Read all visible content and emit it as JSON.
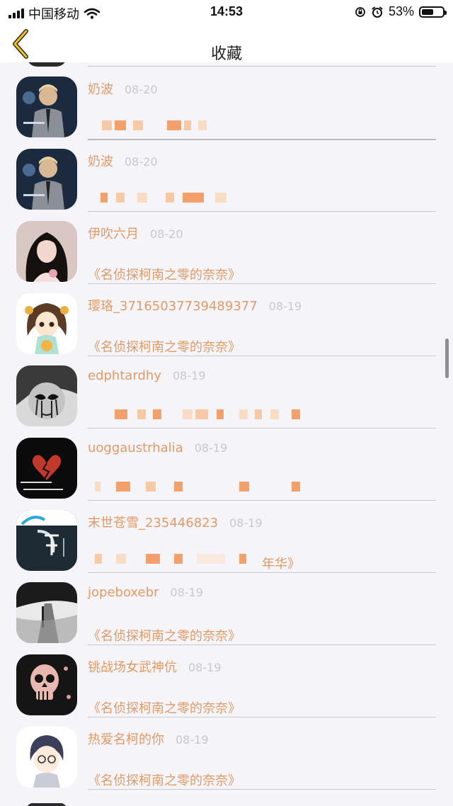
{
  "status_bar": {
    "carrier": "中国移动",
    "time": "14:53",
    "battery": "53%"
  },
  "nav": {
    "title": "收藏"
  },
  "items": [
    {
      "name": "奶波",
      "date": "08-20",
      "content": ""
    },
    {
      "name": "奶波",
      "date": "08-20",
      "content": ""
    },
    {
      "name": "伊吹六月",
      "date": "08-20",
      "content": "《名侦探柯南之零的奈奈》"
    },
    {
      "name": "璎珞_37165037739489377",
      "date": "08-19",
      "content": "《名侦探柯南之零的奈奈》"
    },
    {
      "name": "edphtardhy",
      "date": "08-19",
      "content": ""
    },
    {
      "name": "uoggaustrhalia",
      "date": "08-19",
      "content": ""
    },
    {
      "name": "末世苍雪_235446823",
      "date": "08-19",
      "content": "年华》"
    },
    {
      "name": "jopeboxebr",
      "date": "08-19",
      "content": "《名侦探柯南之零的奈奈》"
    },
    {
      "name": "铫战场女武神伉",
      "date": "08-19",
      "content": "《名侦探柯南之零的奈奈》"
    },
    {
      "name": "热爱名柯的你",
      "date": "08-19",
      "content": "《名侦探柯南之零的奈奈》"
    }
  ]
}
